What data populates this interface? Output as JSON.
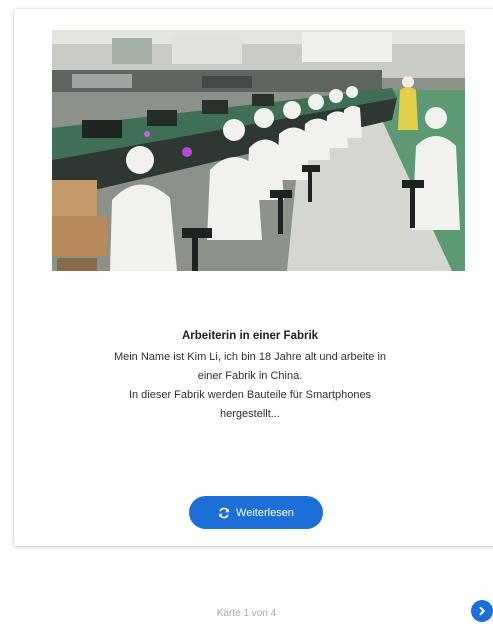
{
  "card": {
    "image_alt": "Arbeiterin in einer Fabrik",
    "title": "Arbeiterin in einer Fabrik",
    "body_lines": [
      "Mein Name ist Kim Li, ich bin 18 Jahre alt und arbeite in",
      "einer Fabrik in China.",
      "In dieser Fabrik werden Bauteile für Smartphones",
      "hergestellt..."
    ],
    "read_more_label": "Weiterlesen",
    "read_more_icon": "refresh-icon"
  },
  "pager": {
    "text": "Karte 1 von 4",
    "next_icon": "chevron-right-icon"
  },
  "colors": {
    "accent": "#1d6fd8",
    "pager_text": "#a9a9a9"
  }
}
